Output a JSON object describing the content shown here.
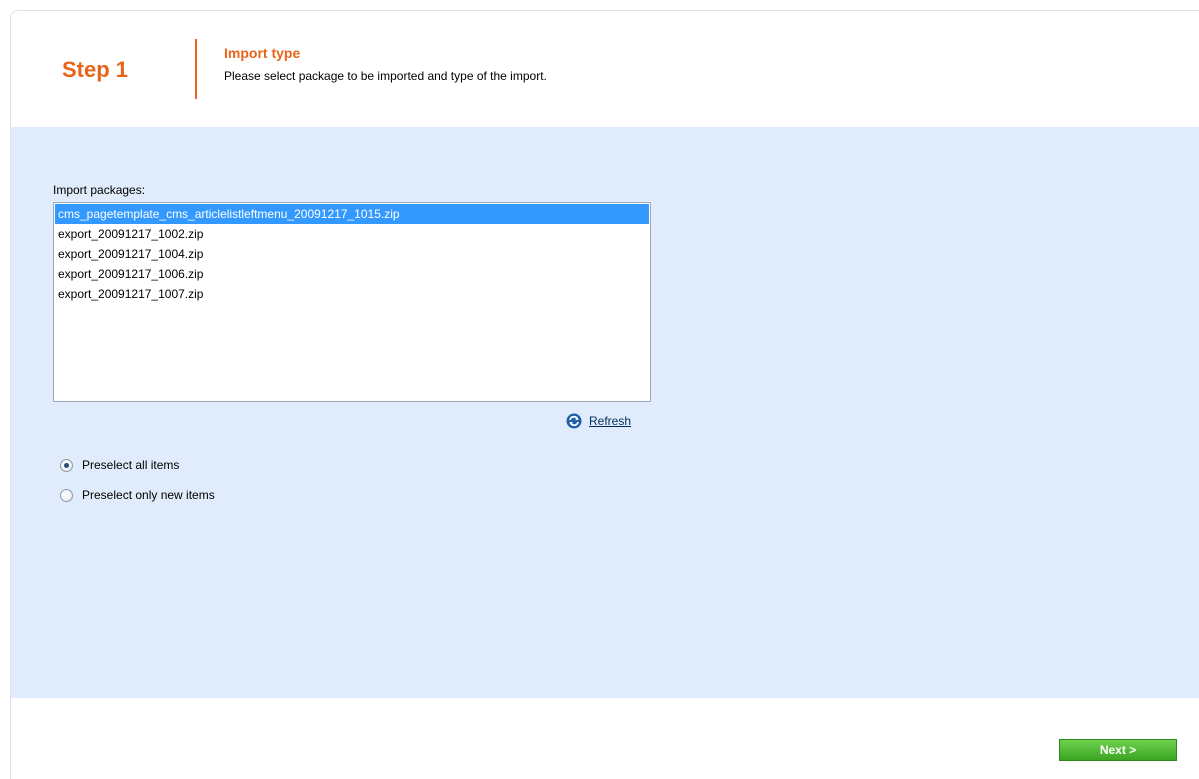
{
  "header": {
    "step": "Step 1",
    "title": "Import type",
    "description": "Please select package to be imported and type of the import."
  },
  "packages": {
    "label": "Import packages:",
    "items": [
      "cms_pagetemplate_cms_articlelistleftmenu_20091217_1015.zip",
      "export_20091217_1002.zip",
      "export_20091217_1004.zip",
      "export_20091217_1006.zip",
      "export_20091217_1007.zip"
    ],
    "selected_index": 0
  },
  "refresh": {
    "label": "Refresh",
    "icon": "refresh-icon"
  },
  "options": {
    "preselect_all": {
      "label": "Preselect all items",
      "checked": true
    },
    "preselect_new": {
      "label": "Preselect only new items",
      "checked": false
    }
  },
  "footer": {
    "next_label": "Next >"
  },
  "colors": {
    "accent": "#e8641b",
    "content_bg": "#e0ebfb",
    "selection": "#3399ff",
    "next_button": "#4bb832"
  }
}
